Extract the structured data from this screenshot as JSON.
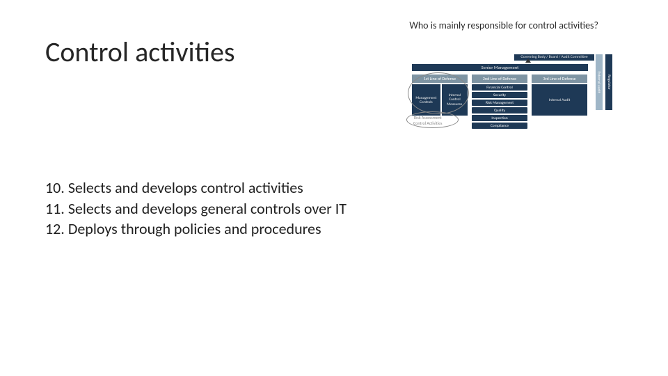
{
  "title": "Control activities",
  "question": "Who is mainly responsible for control activities?",
  "bullets": {
    "b10": "10. Selects and develops control activities",
    "b11": "11. Selects and develops general controls over IT",
    "b12": "12. Deploys through policies and procedures"
  },
  "diagram": {
    "governing": "Governing Body / Board / Audit Committee",
    "senior": "Senior Management",
    "line1_head": "1st Line of Defense",
    "line1_mgt": "Management Controls",
    "line1_icm": "Internal Control Measures",
    "line2_head": "2nd Line of Defense",
    "line2_items": {
      "a": "Financial Control",
      "b": "Security",
      "c": "Risk Management",
      "d": "Quality",
      "e": "Inspection",
      "f": "Compliance"
    },
    "line3_head": "3rd Line of Defense",
    "line3_body": "Internal Audit",
    "side_ea": "External audit",
    "side_reg": "Regulator",
    "caption1": "Risk Assessment",
    "caption2": "Control Activities"
  }
}
